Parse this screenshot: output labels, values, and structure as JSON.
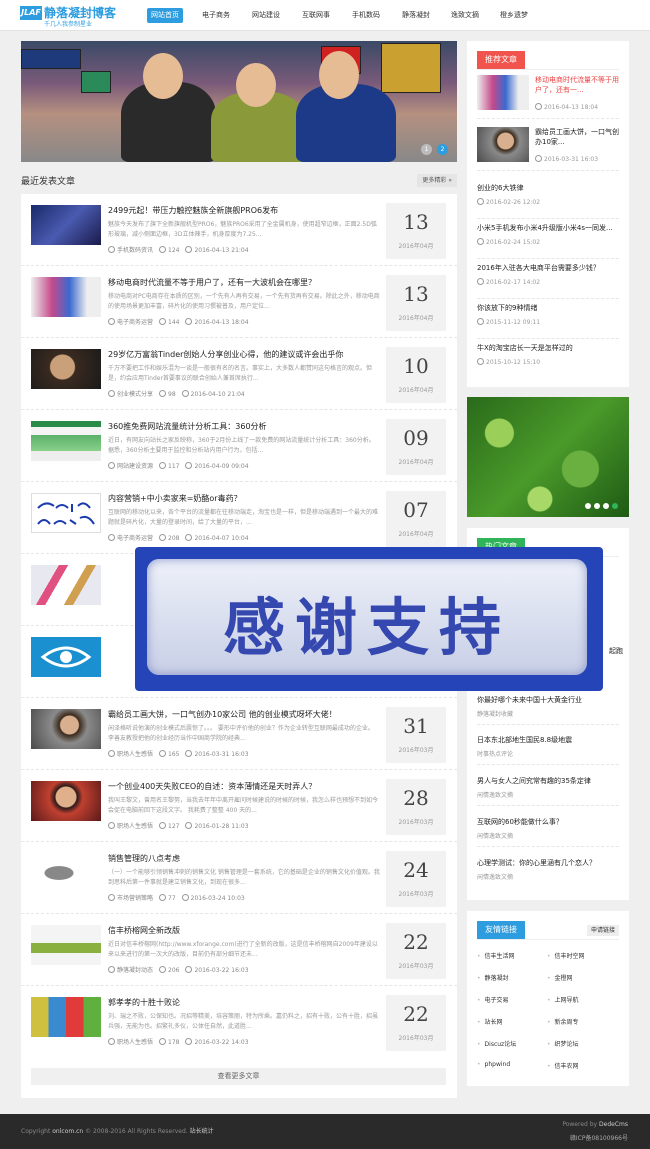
{
  "header": {
    "logo_mark": "JLAF",
    "logo_title": "静落凝封博客",
    "logo_sub": "千几人我参制星业",
    "nav": [
      "网站首页",
      "电子商务",
      "网站建设",
      "互联网事",
      "手机数码",
      "静落凝封",
      "逸致文摘",
      "橙乡遗梦"
    ]
  },
  "banner": {
    "dots": [
      "1",
      "2"
    ]
  },
  "main": {
    "section_title": "最近发表文章",
    "more_label": "更多精彩 »",
    "load_more": "查看更多文章"
  },
  "articles": [
    {
      "title": "2499元起！带压力触控魅族全新旗舰PRO6发布",
      "desc": "魅族今天发布了旗下全新旗舰机型PRO6，魅族PRO6采用了全金属机身，使用超窄边框，正面2.5D弧形玻璃，减小侧面边框，3D立体辣手，机身厚度为7.25...",
      "category": "手机数码资讯",
      "views": "124",
      "date": "2016-04-13 21:04",
      "day": "13",
      "month": "2016年04月"
    },
    {
      "title": "移动电商时代流量不等于用户了，还有一大波机会在哪里？",
      "desc": "移动电商对PC电商存在本质的区别，一个先有人再有交易，一个先有货再有交易。除此之外，移动电商的使用场景更加丰富，碎片化的使用习惯被普及，用户定位...",
      "category": "电子商务运营",
      "views": "144",
      "date": "2016-04-13 18:04",
      "day": "13",
      "month": "2016年04月"
    },
    {
      "title": "29岁亿万富翁Tinder创始人分享创业心得，他的建议或许会出乎你",
      "desc": "千万不要把工作和娱乐混为一谈是一般很有名的名言。事实上，大多数人都赞同这句格言的观点。但是，约会应用Tinder首要事议的联合创始人兼首席执行...",
      "category": "创业模式分享",
      "views": "98",
      "date": "2016-04-10 21:04",
      "day": "10",
      "month": "2016年04月"
    },
    {
      "title": "360推免费网站流量统计分析工具：360分析",
      "desc": "近日，有网友向站长之家反映称，360于2月份上线了一款免费的网站流量统计分析工具：360分析。据悉，360分析主要用于监控和分析站内用户行为，包括...",
      "category": "网站建设资源",
      "views": "117",
      "date": "2016-04-09 09:04",
      "day": "09",
      "month": "2016年04月"
    },
    {
      "title": "内容营销+中小卖家来=奶酪or毒药？",
      "desc": "互联网的移动化以来，各个平台的流量都在往移动端走，淘宝也是一样，但是移动端遇到一个最大的难题就是碎片化，大量的登录时间，给了大量的平台，...",
      "category": "电子商务运营",
      "views": "208",
      "date": "2016-04-07 10:04",
      "day": "07",
      "month": "2016年04月"
    },
    {
      "title": "",
      "desc": "",
      "category": "",
      "views": "",
      "date": "",
      "day": "",
      "month": ""
    },
    {
      "title": "",
      "desc": "",
      "category": "",
      "views": "",
      "date": "",
      "day": "",
      "month": ""
    },
    {
      "title": "霸给员工画大饼，一口气创办10家公司 他的创业模式呀坏大佬！",
      "desc": "闲泽格听说他演的创业模式后震惊了。。。 要形中评价他的创业？作为企业转型互联网最成功的企业。 李善友教授把他的创业经历当作中国商学院的经典...",
      "category": "职场人生感悟",
      "views": "165",
      "date": "2016-03-31 16:03",
      "day": "31",
      "month": "2016年03月"
    },
    {
      "title": "一个创业400天失败CEO的自述：资本薄情还是天时弄人？",
      "desc": "我叫王黎文，曾用名王黎努，当我去年年中离开雇问时候建说的时候的时候，我怎么样也预想不到如今会促在电脑前回下这段文字。 我耗费了整整 400 天的...",
      "category": "职场人生感悟",
      "views": "127",
      "date": "2016-01-28 11:03",
      "day": "28",
      "month": "2016年03月"
    },
    {
      "title": "销售管理的八点考虑",
      "desc": "（一）一个能够引领销售冲刺的销售文化 销售管理是一套系统，它的基础是企业的销售文化价值观。我到思科后第一件事就是建立销售文化，到现在很多...",
      "category": "市场营销策略",
      "views": "77",
      "date": "2016-03-24 10:03",
      "day": "24",
      "month": "2016年03月"
    },
    {
      "title": "信丰桥榕网全新改版",
      "desc": "近日对信丰桥榕网(http://www.xforange.com)进行了全新的改版，这是信丰桥榕网自2009年建设以来以来进行的第一次大的改版，目前仍有部分细节还未...",
      "category": "静落凝封动态",
      "views": "206",
      "date": "2016-03-22 16:03",
      "day": "22",
      "month": "2016年03月"
    },
    {
      "title": "郭孝孝的十胜十败论",
      "desc": "刘、瑞之不败，公保知也。况招等精美，培容策丽，特为所乘。嘉仍料之，招有十败，公有十胜，招虽兵强，无能为也。招繁礼多仪，公体任自然，此道胜...",
      "category": "职场人生感悟",
      "views": "178",
      "date": "2016-03-22 14:03",
      "day": "22",
      "month": "2016年03月"
    }
  ],
  "sidebar": {
    "recommend_tab": "推荐文章",
    "recommend": [
      {
        "title": "移动电商时代流量不等于用户了，还有一...",
        "date": "2016-04-13 18:04",
        "hot": true
      },
      {
        "title": "霸给员工画大饼，一口气创办10家...",
        "date": "2016-03-31 16:03",
        "hot": false
      }
    ],
    "recent": [
      {
        "title": "创业的6大铁律",
        "date": "2016-02-26 12:02"
      },
      {
        "title": "小米5手机发布小米4升级版小米4s一同发...",
        "date": "2016-02-24 15:02"
      },
      {
        "title": "2016年入驻各大电商平台需要多少钱？",
        "date": "2016-02-17 14:02"
      },
      {
        "title": "你该放下的9种情绪",
        "date": "2015-11-12 09:11"
      },
      {
        "title": "牛X的淘宝店长一天是怎样过的",
        "date": "2015-10-12 15:10"
      }
    ],
    "slider_dots": [
      "1",
      "2",
      "3",
      "4"
    ],
    "hot_tab": "热门文章",
    "hot_partial": "起跑",
    "hot": [
      {
        "title": "你最好哪个未来中国十大黄金行业",
        "category": "静落凝封收藏"
      },
      {
        "title": "日本东北部地生国民8.8级地震",
        "category": "时事热点评论"
      },
      {
        "title": "男人与女人之间究常有趣的35条定律",
        "category": "闲情逸致文摘"
      },
      {
        "title": "互联网的60秒能做什么事？",
        "category": "闲情逸致文摘"
      },
      {
        "title": "心理学测试：你的心里涵有几个恋人？",
        "category": "闲情逸致文摘"
      }
    ],
    "links_tab": "友情链接",
    "links_apply": "申请链接",
    "links": [
      "信丰生活网",
      "信丰时空网",
      "静落凝封",
      "金橙网",
      "电子交易",
      "上网导航",
      "站长网",
      "新余周专",
      "Discuz论坛",
      "织梦论坛",
      "phpwind",
      "信丰农网"
    ]
  },
  "overlay": {
    "text": "感谢支持"
  },
  "footer": {
    "copyright_prefix": "Copyright",
    "domain": "onlcom.cn",
    "copyright_rest": "© 2008-2016 All Rights Reserved.",
    "stats": "站长统计",
    "powered_label": "Powered by",
    "powered_by": "DedeCms",
    "icp": "赣ICP备08100966号"
  },
  "colors": {
    "accent": "#2d9de0",
    "recommend": "#f0544c",
    "hot": "#30b45a",
    "footer": "#2a2a2a"
  }
}
